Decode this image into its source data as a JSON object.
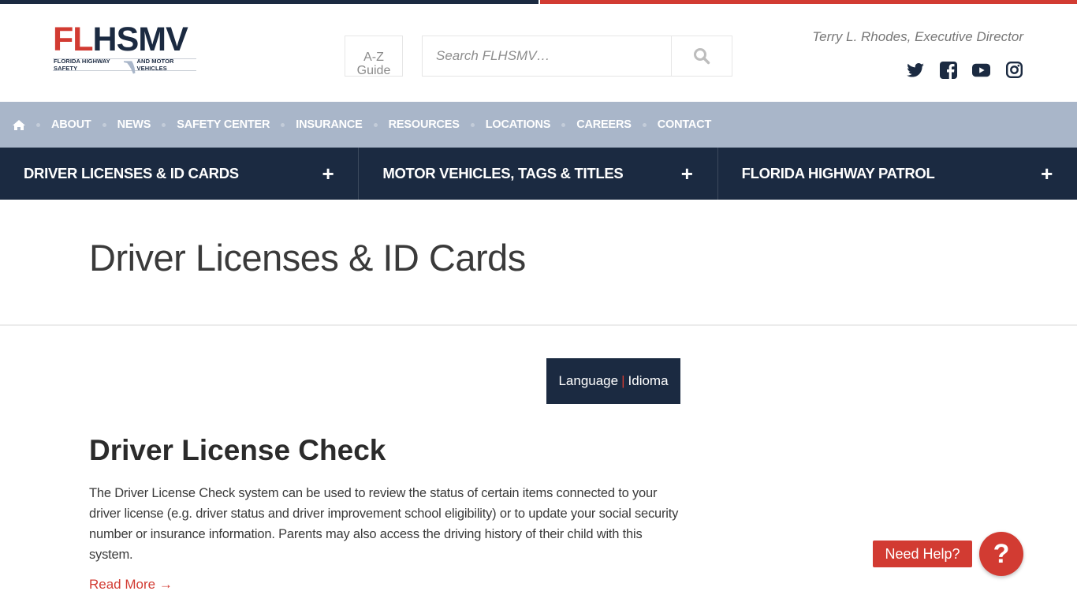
{
  "header": {
    "logo": {
      "letters_red": "FL",
      "letters_navy_h": "H",
      "letters_navy": "SMV",
      "tagline_left": "FLORIDA HIGHWAY SAFETY",
      "tagline_right": "AND MOTOR VEHICLES"
    },
    "az_guide": {
      "line1": "A-Z",
      "line2": "Guide"
    },
    "search": {
      "placeholder": "Search FLHSMV…",
      "value": "",
      "icon": "search-icon"
    },
    "director": "Terry L. Rhodes, Executive Director",
    "social": [
      {
        "name": "twitter",
        "icon": "twitter-icon"
      },
      {
        "name": "facebook",
        "icon": "facebook-icon"
      },
      {
        "name": "youtube",
        "icon": "youtube-icon"
      },
      {
        "name": "instagram",
        "icon": "instagram-icon"
      }
    ]
  },
  "utility_nav": {
    "home_icon": "home-icon",
    "items": [
      "ABOUT",
      "NEWS",
      "SAFETY CENTER",
      "INSURANCE",
      "RESOURCES",
      "LOCATIONS",
      "CAREERS",
      "CONTACT"
    ]
  },
  "main_nav": {
    "tabs": [
      {
        "label": "DRIVER LICENSES & ID CARDS",
        "toggle": "+"
      },
      {
        "label": "MOTOR VEHICLES, TAGS & TITLES",
        "toggle": "+"
      },
      {
        "label": "FLORIDA HIGHWAY PATROL",
        "toggle": "+"
      }
    ]
  },
  "page": {
    "title": "Driver Licenses & ID Cards",
    "language_button": {
      "left": "Language",
      "divider": "|",
      "right": "Idioma"
    },
    "section": {
      "title": "Driver License Check",
      "body": "The Driver License Check system can be used to review the status of certain items connected to your driver license (e.g. driver status and driver improvement school eligibility) or to update your social security number or insurance information. Parents may also access the driving history of their child with this system.",
      "link": "Read More →"
    }
  },
  "help": {
    "label": "Need Help?",
    "icon_glyph": "?"
  },
  "colors": {
    "navy": "#1b2a41",
    "red": "#d23b32",
    "utility_bg": "#a9b6c9"
  }
}
